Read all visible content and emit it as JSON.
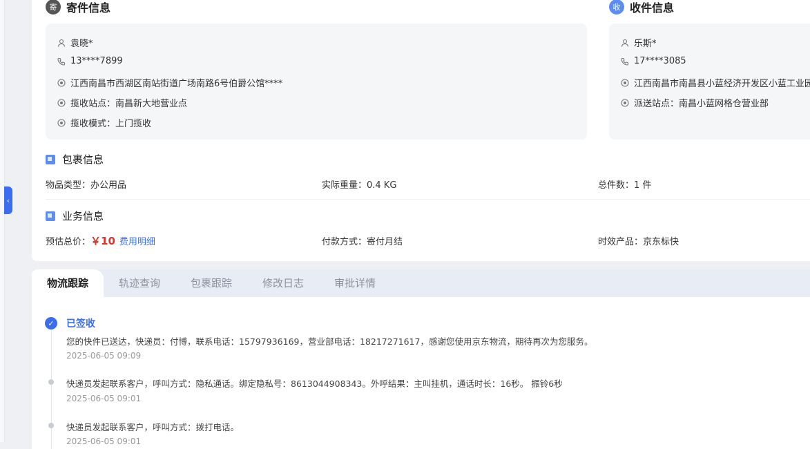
{
  "sender": {
    "badge": "寄",
    "title": "寄件信息",
    "name": "袁晓*",
    "phone": "13****7899",
    "address": "江西南昌市西湖区南站街道广场南路6号伯爵公馆****",
    "pickup_station": "揽收站点：南昌新大地营业点",
    "pickup_mode": "揽收模式：上门揽收"
  },
  "receiver": {
    "badge": "收",
    "title": "收件信息",
    "name": "乐斯*",
    "phone": "17****3085",
    "address": "江西南昌市南昌县小蓝经济开发区小蓝工业园",
    "delivery_station": "派送站点：南昌小蓝网格仓营业部"
  },
  "package": {
    "title": "包裹信息",
    "item_type": "物品类型：办公用品",
    "weight": "实际重量：0.4 KG",
    "count": "总件数：1 件"
  },
  "business": {
    "title": "业务信息",
    "price_label": "预估总价：",
    "price": "￥10",
    "fee_link": "费用明细",
    "payment": "付款方式：寄付月结",
    "product": "时效产品：京东标快"
  },
  "tabs": [
    "物流跟踪",
    "轨迹查询",
    "包裹跟踪",
    "修改日志",
    "审批详情"
  ],
  "timeline": [
    {
      "title": "已签收",
      "text": "您的快件已送达，快递员：付博，联系电话：15797936169，营业部电话：18217271617，感谢您使用京东物流，期待再次为您服务。",
      "time": "2025-06-05 09:09"
    },
    {
      "text": "快递员发起联系客户，呼叫方式：隐私通话。绑定隐私号：8613044908343。外呼结果：主叫挂机，通话时长：16秒。 振铃6秒",
      "time": "2025-06-05 09:01"
    },
    {
      "text": "快递员发起联系客户，呼叫方式：拨打电话。",
      "time": "2025-06-05 09:01"
    }
  ],
  "colors": {
    "accent": "#3a6df0",
    "price": "#e0322b",
    "sender_badge": "#555555",
    "receiver_badge": "#5b8ef0"
  }
}
